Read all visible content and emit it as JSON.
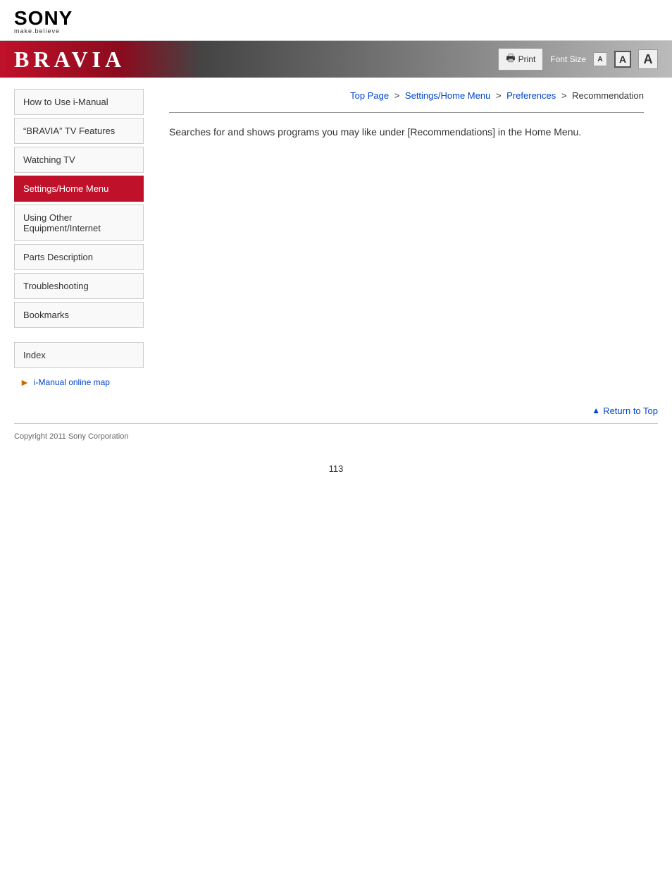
{
  "header": {
    "sony_logo": "SONY",
    "sony_tagline": "make.believe",
    "bravia_title": "BRAVIA"
  },
  "toolbar": {
    "print_label": "Print",
    "font_size_label": "Font Size",
    "font_small": "A",
    "font_medium": "A",
    "font_large": "A"
  },
  "breadcrumb": {
    "top_page": "Top Page",
    "settings_home_menu": "Settings/Home Menu",
    "preferences": "Preferences",
    "current": "Recommendation",
    "sep1": " > ",
    "sep2": " > ",
    "sep3": " > "
  },
  "sidebar": {
    "items": [
      {
        "label": "How to Use i-Manual",
        "active": false
      },
      {
        "label": "“BRAVIA” TV Features",
        "active": false
      },
      {
        "label": "Watching TV",
        "active": false
      },
      {
        "label": "Settings/Home Menu",
        "active": true
      },
      {
        "label": "Using Other Equipment/Internet",
        "active": false
      },
      {
        "label": "Parts Description",
        "active": false
      },
      {
        "label": "Troubleshooting",
        "active": false
      },
      {
        "label": "Bookmarks",
        "active": false
      }
    ],
    "index_label": "Index",
    "online_map_label": "i-Manual online map"
  },
  "content": {
    "body_text": "Searches for and shows programs you may like under [Recommendations] in the Home Menu."
  },
  "return_to_top": {
    "label": "Return to Top"
  },
  "footer": {
    "copyright": "Copyright 2011 Sony Corporation"
  },
  "page_number": "113"
}
